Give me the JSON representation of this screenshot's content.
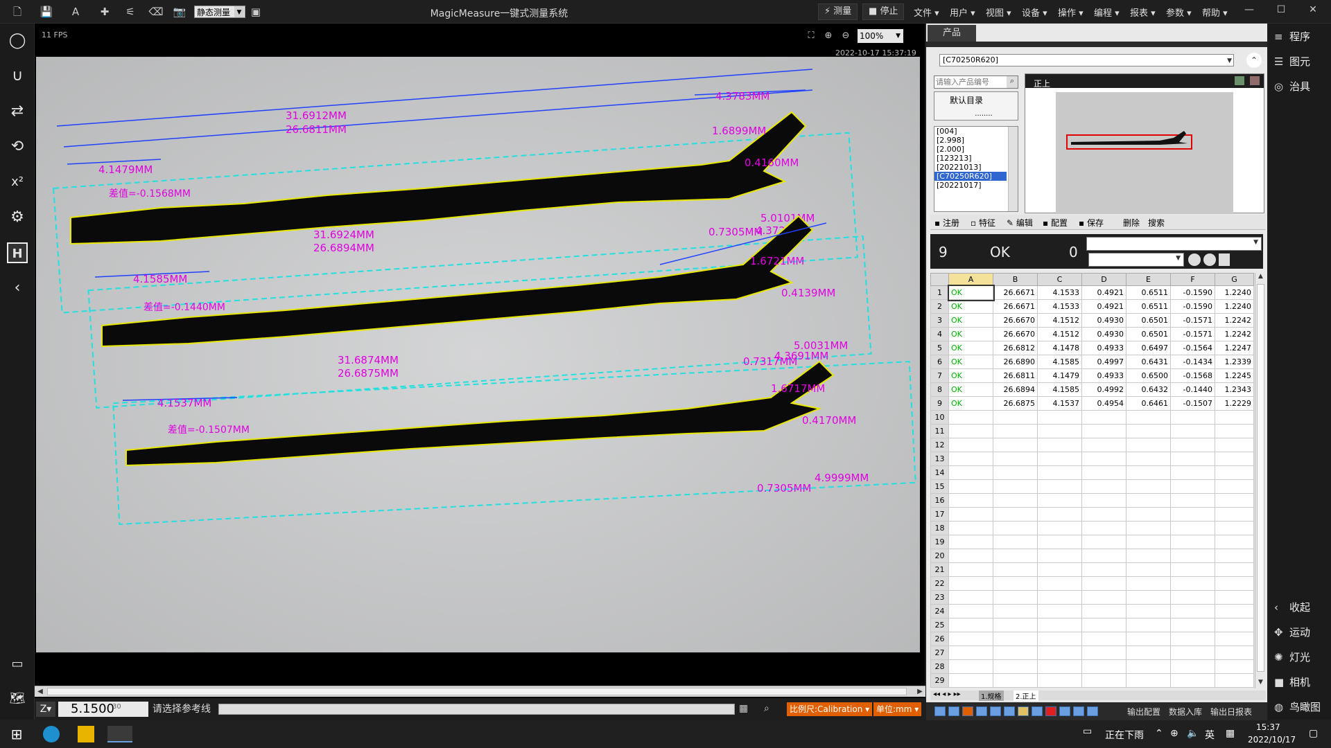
{
  "toolbar": {
    "mode_select": "静态测量",
    "app_title": "MagicMeasure一键式测量系统",
    "run_label": "测量",
    "stop_label": "停止",
    "menus": [
      "文件",
      "用户",
      "视图",
      "设备",
      "操作",
      "编程",
      "报表",
      "参数",
      "帮助"
    ]
  },
  "viewport": {
    "fps": "11 FPS",
    "zoom": "100%",
    "timestamp": "2022-10-17 15:37:19",
    "annotations": {
      "part1": [
        "31.6912MM",
        "26.6811MM",
        "4.3783MM",
        "4.1479MM",
        "差值=-0.1568MM",
        "1.6899MM",
        "0.4160MM",
        "31.6924MM",
        "26.6894MM",
        "5.0101MM",
        "0.7305MM",
        "4.3723MM"
      ],
      "part2": [
        "4.1585MM",
        "1.6721MM",
        "差值=-0.1440MM",
        "0.4139MM",
        "31.6874MM",
        "26.6875MM",
        "5.0031MM",
        "0.7317MM",
        "4.3691MM"
      ],
      "part3": [
        "4.1537MM",
        "差值=-0.1507MM",
        "1.6717MM",
        "0.4170MM",
        "4.9999MM",
        "0.7305MM"
      ]
    }
  },
  "statusbar": {
    "axis_label": "Z",
    "axis_value": "5.1500",
    "axis_extra": "30",
    "hint": "请选择参考线",
    "scale": "比例尺:Calibration",
    "unit": "单位:mm"
  },
  "product": {
    "tab": "产品",
    "selected": "[C70250R620]",
    "search_placeholder": "请输入产品编号",
    "dir": "默认目录",
    "dir_sep": "........",
    "list": [
      "[004]",
      "[2.998]",
      "[2.000]",
      "[123213]",
      "[20221013]",
      "[C70250R620]",
      "[20221017]"
    ],
    "selected_index": 5,
    "preview_label": "正上",
    "actions": [
      "注册",
      "特征",
      "编辑",
      "配置",
      "保存",
      "删除",
      "搜索"
    ]
  },
  "result": {
    "count": "9",
    "status": "OK",
    "ng_count": "0"
  },
  "grid": {
    "columns": [
      "A",
      "B",
      "C",
      "D",
      "E",
      "F",
      "G"
    ],
    "rows": [
      [
        "OK",
        "26.6671",
        "4.1533",
        "0.4921",
        "0.6511",
        "-0.1590",
        "1.2240"
      ],
      [
        "OK",
        "26.6671",
        "4.1533",
        "0.4921",
        "0.6511",
        "-0.1590",
        "1.2240"
      ],
      [
        "OK",
        "26.6670",
        "4.1512",
        "0.4930",
        "0.6501",
        "-0.1571",
        "1.2242"
      ],
      [
        "OK",
        "26.6670",
        "4.1512",
        "0.4930",
        "0.6501",
        "-0.1571",
        "1.2242"
      ],
      [
        "OK",
        "26.6812",
        "4.1478",
        "0.4933",
        "0.6497",
        "-0.1564",
        "1.2247"
      ],
      [
        "OK",
        "26.6890",
        "4.1585",
        "0.4997",
        "0.6431",
        "-0.1434",
        "1.2339"
      ],
      [
        "OK",
        "26.6811",
        "4.1479",
        "0.4933",
        "0.6500",
        "-0.1568",
        "1.2245"
      ],
      [
        "OK",
        "26.6894",
        "4.1585",
        "0.4992",
        "0.6432",
        "-0.1440",
        "1.2343"
      ],
      [
        "OK",
        "26.6875",
        "4.1537",
        "0.4954",
        "0.6461",
        "-0.1507",
        "1.2229"
      ]
    ],
    "row_numbers": [
      "1",
      "2",
      "3",
      "4",
      "5",
      "6",
      "7",
      "8",
      "9",
      "10",
      "11",
      "12",
      "13",
      "14",
      "15",
      "16",
      "17",
      "18",
      "19",
      "20",
      "21",
      "22",
      "23",
      "24",
      "25",
      "26",
      "27",
      "28",
      "29"
    ],
    "sheet_tabs": [
      "1.规格",
      "2.正上"
    ]
  },
  "bottom_tools": [
    "输出配置",
    "数据入库",
    "输出日报表"
  ],
  "right_nav": {
    "top": [
      "程序",
      "图元",
      "治具"
    ],
    "bottom": [
      "收起",
      "运动",
      "灯光",
      "相机",
      "鸟瞰图"
    ]
  },
  "taskbar": {
    "weather": "正在下雨",
    "ime": "英",
    "time": "15:37",
    "date": "2022/10/17"
  },
  "colors": {
    "accent_orange": "#e06000",
    "ok_green": "#00b000",
    "measure_magenta": "#e000e0",
    "measure_blue": "#2040ff",
    "measure_cyan": "#20e0e0",
    "selection_blue": "#2f66d0"
  }
}
